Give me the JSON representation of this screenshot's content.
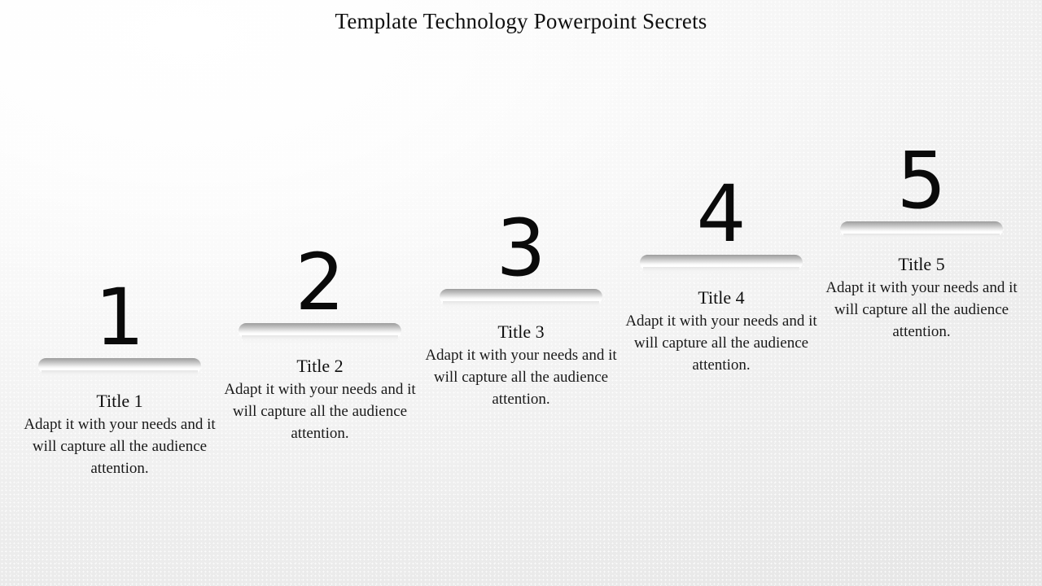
{
  "slide": {
    "title": "Template Technology Powerpoint Secrets",
    "background_color": "#ececec",
    "text_color": "#101010",
    "bar_color_top": "#9c9c9c",
    "bar_color_bottom": "#ffffff"
  },
  "steps": [
    {
      "numeral": "1",
      "title": "Title 1",
      "description": "Adapt it with your needs and it will capture all the audience attention."
    },
    {
      "numeral": "2",
      "title": "Title 2",
      "description": "Adapt it with your needs and it will capture all the audience attention."
    },
    {
      "numeral": "3",
      "title": "Title 3",
      "description": "Adapt it with your needs and it will capture all the audience attention."
    },
    {
      "numeral": "4",
      "title": "Title 4",
      "description": "Adapt it with your needs and it will capture all the audience attention."
    },
    {
      "numeral": "5",
      "title": "Title 5",
      "description": "Adapt it with your needs and it will capture all the audience attention."
    }
  ]
}
